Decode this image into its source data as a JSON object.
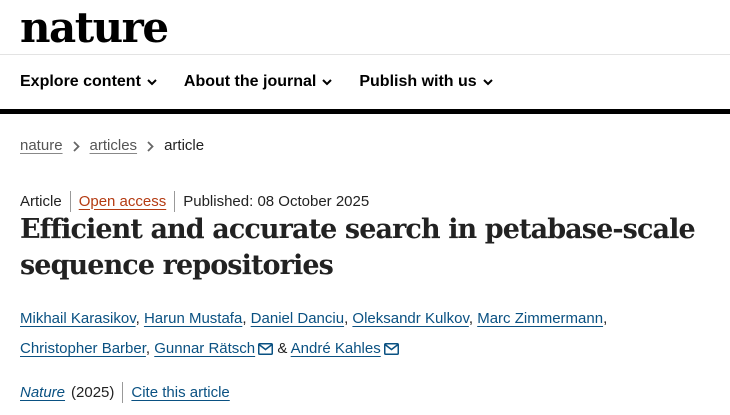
{
  "site": {
    "logo": "nature"
  },
  "nav": {
    "items": [
      {
        "label": "Explore content"
      },
      {
        "label": "About the journal"
      },
      {
        "label": "Publish with us"
      }
    ]
  },
  "breadcrumb": {
    "items": [
      "nature",
      "articles"
    ],
    "current": "article"
  },
  "article": {
    "type": "Article",
    "access": "Open access",
    "published": "Published: 08 October 2025",
    "title": "Efficient and accurate search in petabase-scale sequence repositories",
    "authors": [
      "Mikhail Karasikov",
      "Harun Mustafa",
      "Daniel Danciu",
      "Oleksandr Kulkov",
      "Marc Zimmermann",
      "Christopher Barber",
      "Gunnar Rätsch",
      "André Kahles"
    ],
    "author_separator": ",",
    "author_conjunction": "&",
    "journal": "Nature",
    "year": "(2025)",
    "cite_label": "Cite this article"
  },
  "colors": {
    "link": "#0a5182",
    "open_access": "#b43b12",
    "text": "#222222"
  },
  "icons": {
    "nav_dropdown": "chevron-down-icon",
    "breadcrumb_sep": "chevron-right-icon",
    "corresponding_author": "envelope-icon"
  }
}
